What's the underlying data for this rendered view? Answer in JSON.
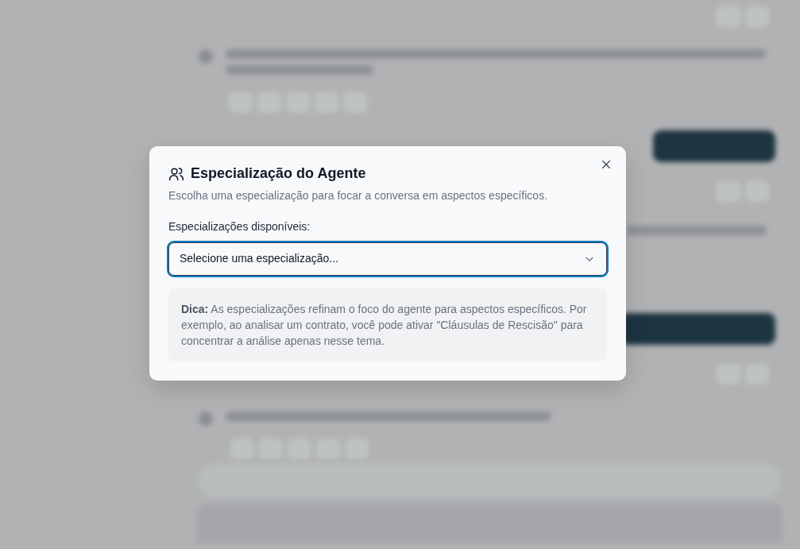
{
  "dialog": {
    "title": "Especialização do Agente",
    "description": "Escolha uma especialização para focar a conversa em aspectos específicos.",
    "field_label": "Especializações disponíveis:",
    "select": {
      "placeholder": "Selecione uma especialização...",
      "focused": true
    },
    "tip": "**Dica:** As especializações refinam o foco do agente para aspectos específicos. Por exemplo, ao analisar um contrato, você pode ativar \"Cláusulas de Rescisão\" para concentrar a análise apenas nesse tema."
  }
}
